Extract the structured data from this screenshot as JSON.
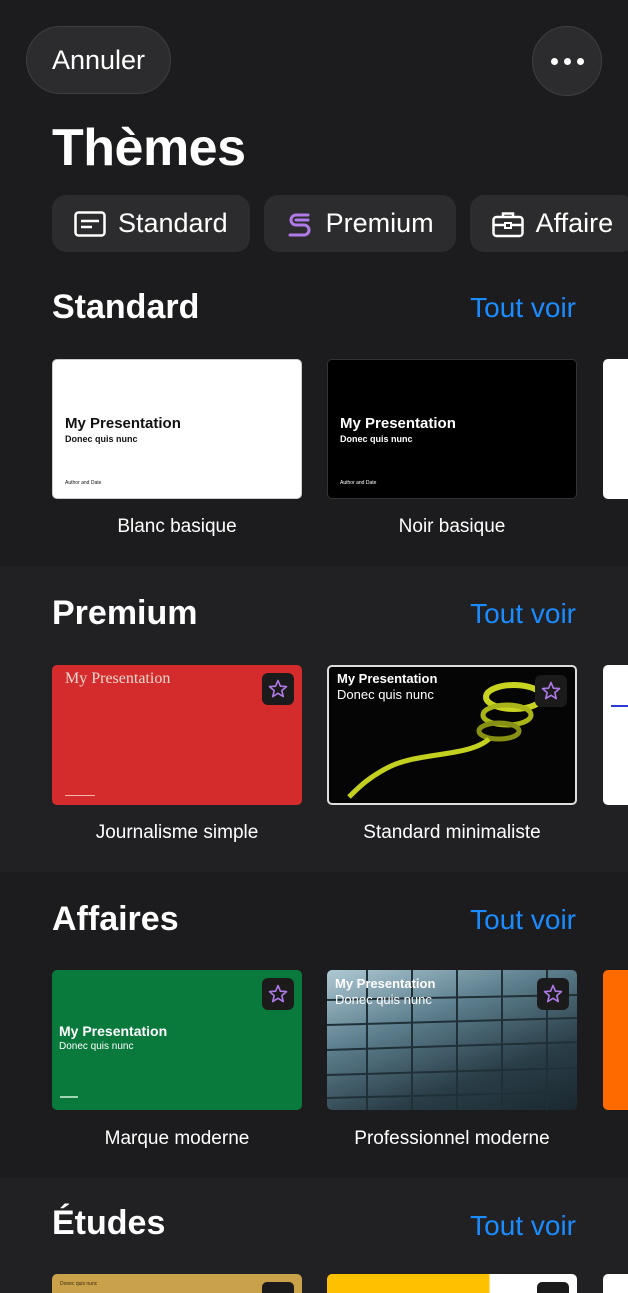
{
  "header": {
    "cancel_label": "Annuler",
    "more_label": "Plus d'options"
  },
  "page_title": "Thèmes",
  "chips": [
    {
      "label": "Standard",
      "icon": "slide-icon"
    },
    {
      "label": "Premium",
      "icon": "premium-icon"
    },
    {
      "label": "Affaire",
      "icon": "briefcase-icon"
    }
  ],
  "sections": [
    {
      "title": "Standard",
      "link": "Tout voir",
      "cards": [
        {
          "label": "Blanc basique",
          "title": "My Presentation",
          "subtitle": "Donec quis nunc",
          "footer": "Author and Date"
        },
        {
          "label": "Noir basique",
          "title": "My Presentation",
          "subtitle": "Donec quis nunc",
          "footer": "Author and Date"
        }
      ]
    },
    {
      "title": "Premium",
      "link": "Tout voir",
      "cards": [
        {
          "label": "Journalisme simple",
          "title": "My Presentation"
        },
        {
          "label": "Standard minimaliste",
          "title": "My Presentation",
          "subtitle": "Donec quis nunc"
        }
      ]
    },
    {
      "title": "Affaires",
      "link": "Tout voir",
      "cards": [
        {
          "label": "Marque moderne",
          "title": "My Presentation",
          "subtitle": "Donec quis nunc"
        },
        {
          "label": "Professionnel moderne",
          "title": "My Presentation",
          "subtitle": "Donec quis nunc"
        }
      ]
    },
    {
      "title": "Études",
      "link": "Tout voir",
      "cards": [
        {
          "subtitle": "Donec quis nunc"
        }
      ]
    }
  ],
  "colors": {
    "accent": "#1a8cff",
    "premium": "#b07ae8",
    "red": "#d42c2c",
    "green": "#0a7a3c",
    "orange": "#ff6a00"
  }
}
